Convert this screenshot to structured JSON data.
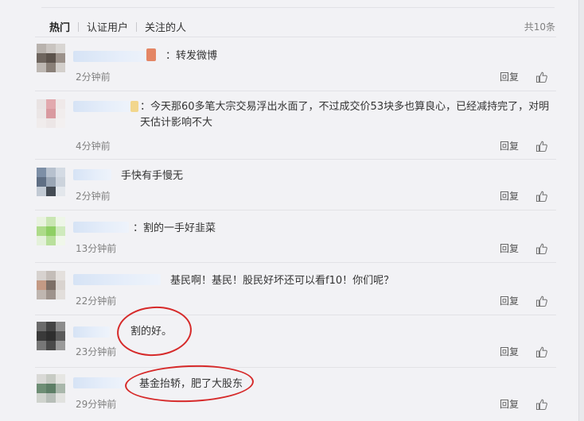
{
  "tabs": [
    "热门",
    "认证用户",
    "关注的人"
  ],
  "total_count": "共10条",
  "reply_label": "回复",
  "comments": [
    {
      "text": "：转发微博",
      "time": "2分钟前"
    },
    {
      "text": "：今天那60多笔大宗交易浮出水面了，不过成交价53块多也算良心，已经减持完了，对明天估计影响不大",
      "time": "4分钟前"
    },
    {
      "text": "手快有手慢无",
      "time": "2分钟前"
    },
    {
      "text": "：割的一手好韭菜",
      "time": "13分钟前"
    },
    {
      "text": "基民啊！基民！股民好坏还可以看f10！你们呢？",
      "time": "22分钟前"
    },
    {
      "text": "割的好。",
      "time": "23分钟前"
    },
    {
      "text": "基金抬轿，肥了大股东",
      "time": "29分钟前"
    }
  ],
  "colors": {
    "highlight_circle": "#d62a2a",
    "meta_text": "#808080"
  },
  "icons": {
    "like": "thumbs-up-icon"
  }
}
